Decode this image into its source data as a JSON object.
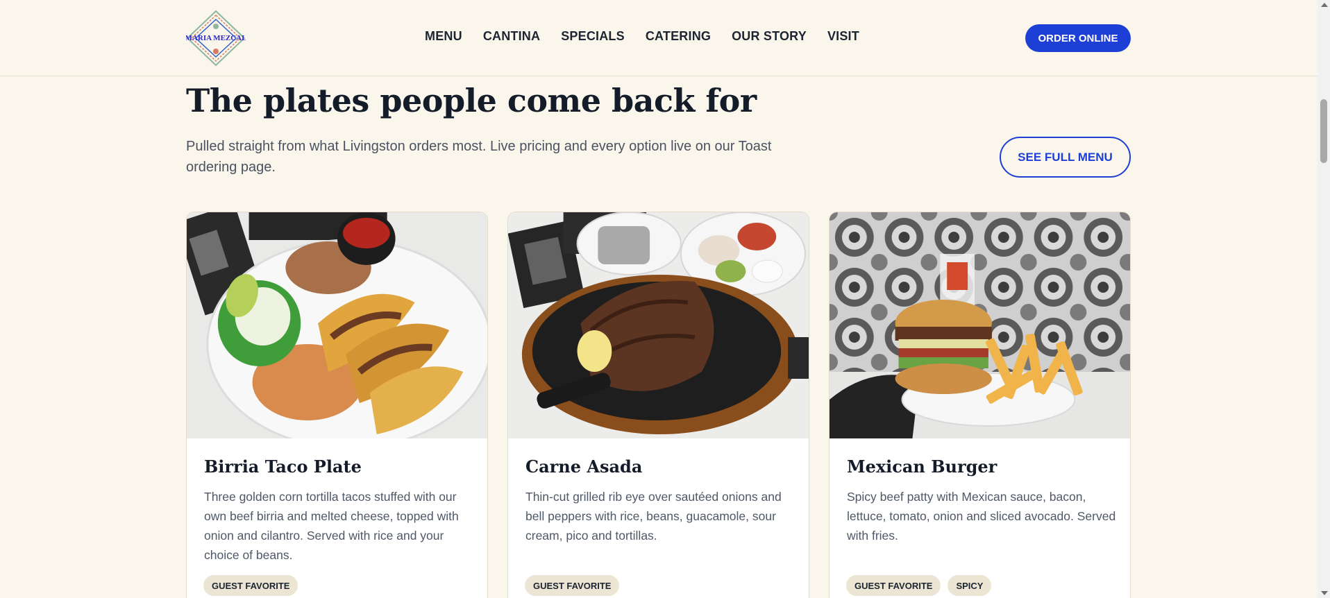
{
  "header": {
    "logo_text": "MARIA MEZCAL",
    "nav": [
      "MENU",
      "CANTINA",
      "SPECIALS",
      "CATERING",
      "OUR STORY",
      "VISIT"
    ],
    "order_button": "ORDER ONLINE"
  },
  "section": {
    "title": "The plates people come back for",
    "subtitle": "Pulled straight from what Livingston orders most. Live pricing and every option live on our Toast ordering page.",
    "see_menu_button": "SEE FULL MENU"
  },
  "cards": [
    {
      "title": "Birria Taco Plate",
      "description": "Three golden corn tortilla tacos stuffed with our own beef birria and melted cheese, topped with onion and cilantro. Served with rice and your choice of beans.",
      "tags": [
        "GUEST FAVORITE"
      ]
    },
    {
      "title": "Carne Asada",
      "description": "Thin-cut grilled rib eye over sautéed onions and bell peppers with rice, beans, guacamole, sour cream, pico and tortillas.",
      "tags": [
        "GUEST FAVORITE"
      ]
    },
    {
      "title": "Mexican Burger",
      "description": "Spicy beef patty with Mexican sauce, bacon, lettuce, tomato, onion and sliced avocado. Served with fries.",
      "tags": [
        "GUEST FAVORITE",
        "SPICY"
      ]
    }
  ],
  "colors": {
    "background": "#faf6ec",
    "accent": "#1d3fd6",
    "card": "#ffffff",
    "tag": "#ece5d3"
  }
}
